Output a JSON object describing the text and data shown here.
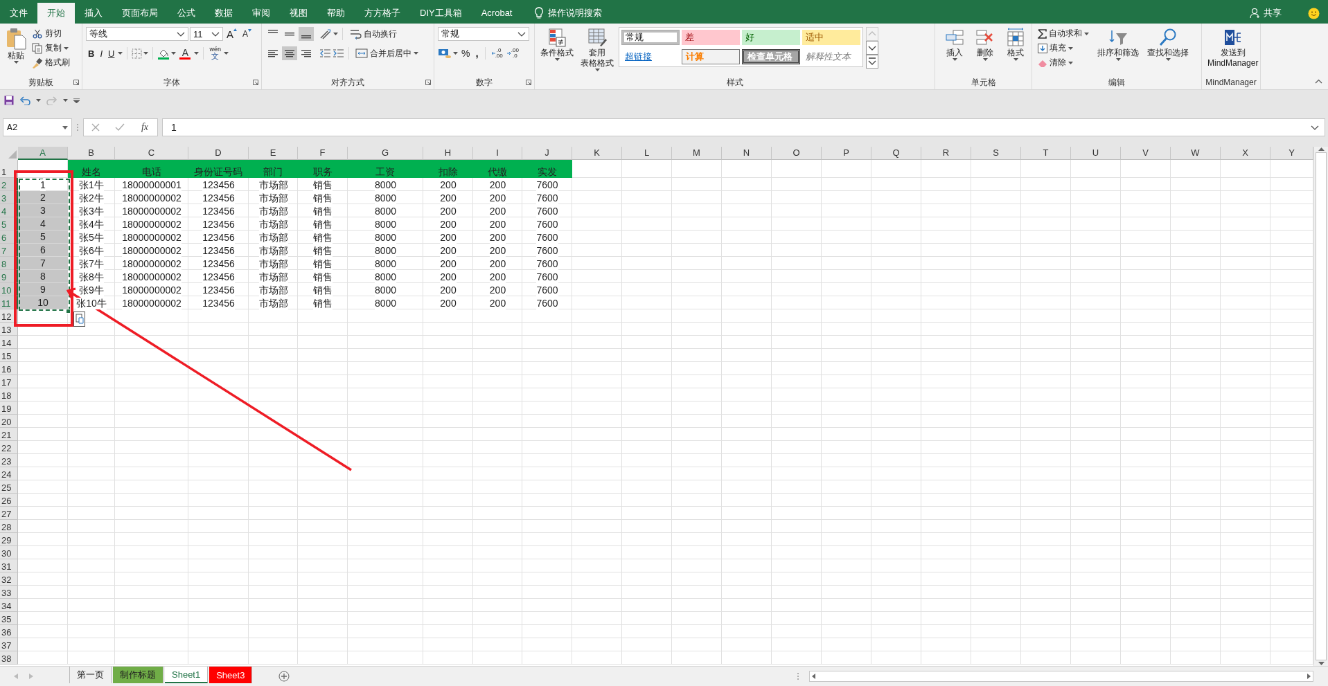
{
  "menu_tabs": [
    {
      "label": "文件",
      "selected": false
    },
    {
      "label": "开始",
      "selected": true
    },
    {
      "label": "插入",
      "selected": false
    },
    {
      "label": "页面布局",
      "selected": false
    },
    {
      "label": "公式",
      "selected": false
    },
    {
      "label": "数据",
      "selected": false
    },
    {
      "label": "审阅",
      "selected": false
    },
    {
      "label": "视图",
      "selected": false
    },
    {
      "label": "帮助",
      "selected": false
    },
    {
      "label": "方方格子",
      "selected": false
    },
    {
      "label": "DIY工具箱",
      "selected": false
    },
    {
      "label": "Acrobat",
      "selected": false
    }
  ],
  "tell_me": "操作说明搜索",
  "share": "共享",
  "ribbon_groups": [
    {
      "kind": "clipboard",
      "title": "剪贴板",
      "paste": "粘贴",
      "cut": "剪切",
      "copy": "复制",
      "format_painter": "格式刷"
    },
    {
      "kind": "font",
      "title": "字体",
      "font_name": "等线",
      "font_size": "11",
      "size_buttons": [
        {
          "kind": "grow",
          "label": "A"
        },
        {
          "kind": "shrink",
          "label": "A"
        }
      ],
      "text_styles": [
        {
          "kind": "bold",
          "label": "B"
        },
        {
          "kind": "italic",
          "label": "I"
        },
        {
          "kind": "underline",
          "label": "U"
        }
      ],
      "font_color": "A",
      "phonetic": {
        "top": "wén",
        "bottom": "文"
      }
    },
    {
      "kind": "alignment",
      "title": "对齐方式",
      "vertical_align": [
        {
          "selected": false
        },
        {
          "selected": false
        },
        {
          "selected": true
        }
      ],
      "horizontal_align": [
        {
          "selected": false
        },
        {
          "selected": true
        },
        {
          "selected": false
        }
      ],
      "wrap": "自动换行",
      "merge": "合并后居中"
    },
    {
      "kind": "number",
      "title": "数字",
      "format": "常规",
      "percent": "%",
      "comma": ",",
      "decimal_buttons": [
        {
          "kind": "increase",
          "lines": [
            ".0",
            ".00"
          ]
        },
        {
          "kind": "decrease",
          "lines": [
            ".00",
            ".0"
          ]
        }
      ]
    },
    {
      "kind": "styles",
      "title": "样式",
      "conditional": [
        "条件格式"
      ],
      "table_format": [
        "套用",
        "表格格式"
      ],
      "cell_styles": [
        {
          "kind": "normal",
          "label": "常规",
          "selected": true
        },
        {
          "kind": "bad",
          "label": "差",
          "selected": false
        },
        {
          "kind": "good",
          "label": "好",
          "selected": false
        },
        {
          "kind": "neutral",
          "label": "适中",
          "selected": false
        },
        {
          "kind": "hyperlink",
          "label": "超链接",
          "selected": false
        },
        {
          "kind": "calculation",
          "label": "计算",
          "selected": false
        },
        {
          "kind": "check",
          "label": "检查单元格",
          "selected": false
        },
        {
          "kind": "explanatory",
          "label": "解释性文本",
          "selected": false
        }
      ]
    },
    {
      "kind": "cells",
      "title": "单元格",
      "buttons": [
        {
          "kind": "insert",
          "label": "插入"
        },
        {
          "kind": "delete",
          "label": "删除"
        },
        {
          "kind": "format",
          "label": "格式"
        }
      ]
    },
    {
      "kind": "editing",
      "title": "编辑",
      "autosum": "自动求和",
      "fill": "填充",
      "clear": "清除",
      "sort": "排序和筛选",
      "find": "查找和选择"
    },
    {
      "kind": "mindmanager",
      "title": "MindManager",
      "send": [
        "发送到",
        "MindManager"
      ]
    }
  ],
  "formula_bar": {
    "name_box": "A2",
    "function_label": "fx",
    "value": "1"
  },
  "grid": {
    "columns": [
      {
        "label": "A",
        "selected": true
      },
      {
        "label": "B",
        "selected": false
      },
      {
        "label": "C",
        "selected": false
      },
      {
        "label": "D",
        "selected": false
      },
      {
        "label": "E",
        "selected": false
      },
      {
        "label": "F",
        "selected": false
      },
      {
        "label": "G",
        "selected": false
      },
      {
        "label": "H",
        "selected": false
      },
      {
        "label": "I",
        "selected": false
      },
      {
        "label": "J",
        "selected": false
      },
      {
        "label": "K",
        "selected": false
      },
      {
        "label": "L",
        "selected": false
      },
      {
        "label": "M",
        "selected": false
      },
      {
        "label": "N",
        "selected": false
      },
      {
        "label": "O",
        "selected": false
      },
      {
        "label": "P",
        "selected": false
      },
      {
        "label": "Q",
        "selected": false
      },
      {
        "label": "R",
        "selected": false
      },
      {
        "label": "S",
        "selected": false
      },
      {
        "label": "T",
        "selected": false
      },
      {
        "label": "U",
        "selected": false
      },
      {
        "label": "V",
        "selected": false
      },
      {
        "label": "W",
        "selected": false
      },
      {
        "label": "X",
        "selected": false
      },
      {
        "label": "Y",
        "selected": false
      }
    ],
    "row_headers": [
      {
        "label": "1",
        "selected": false
      },
      {
        "label": "2",
        "selected": true
      },
      {
        "label": "3",
        "selected": true
      },
      {
        "label": "4",
        "selected": true
      },
      {
        "label": "5",
        "selected": true
      },
      {
        "label": "6",
        "selected": true
      },
      {
        "label": "7",
        "selected": true
      },
      {
        "label": "8",
        "selected": true
      },
      {
        "label": "9",
        "selected": true
      },
      {
        "label": "10",
        "selected": true
      },
      {
        "label": "11",
        "selected": true
      },
      {
        "label": "12",
        "selected": false
      },
      {
        "label": "13",
        "selected": false
      },
      {
        "label": "14",
        "selected": false
      },
      {
        "label": "15",
        "selected": false
      },
      {
        "label": "16",
        "selected": false
      },
      {
        "label": "17",
        "selected": false
      },
      {
        "label": "18",
        "selected": false
      },
      {
        "label": "19",
        "selected": false
      },
      {
        "label": "20",
        "selected": false
      },
      {
        "label": "21",
        "selected": false
      },
      {
        "label": "22",
        "selected": false
      },
      {
        "label": "23",
        "selected": false
      },
      {
        "label": "24",
        "selected": false
      },
      {
        "label": "25",
        "selected": false
      },
      {
        "label": "26",
        "selected": false
      },
      {
        "label": "27",
        "selected": false
      },
      {
        "label": "28",
        "selected": false
      },
      {
        "label": "29",
        "selected": false
      },
      {
        "label": "30",
        "selected": false
      },
      {
        "label": "31",
        "selected": false
      },
      {
        "label": "32",
        "selected": false
      },
      {
        "label": "33",
        "selected": false
      },
      {
        "label": "34",
        "selected": false
      },
      {
        "label": "35",
        "selected": false
      },
      {
        "label": "36",
        "selected": false
      },
      {
        "label": "37",
        "selected": false
      },
      {
        "label": "38",
        "selected": false
      }
    ],
    "header_row": [
      "姓名",
      "电话",
      "身份证号码",
      "部门",
      "职务",
      "工资",
      "扣除",
      "代缴",
      "实发"
    ],
    "rows": [
      {
        "selected": true,
        "active": true,
        "cells": [
          "1",
          "张1牛",
          "18000000001",
          "123456",
          "市场部",
          "销售",
          "8000",
          "200",
          "200",
          "7600"
        ]
      },
      {
        "selected": true,
        "active": false,
        "cells": [
          "2",
          "张2牛",
          "18000000002",
          "123456",
          "市场部",
          "销售",
          "8000",
          "200",
          "200",
          "7600"
        ]
      },
      {
        "selected": true,
        "active": false,
        "cells": [
          "3",
          "张3牛",
          "18000000002",
          "123456",
          "市场部",
          "销售",
          "8000",
          "200",
          "200",
          "7600"
        ]
      },
      {
        "selected": true,
        "active": false,
        "cells": [
          "4",
          "张4牛",
          "18000000002",
          "123456",
          "市场部",
          "销售",
          "8000",
          "200",
          "200",
          "7600"
        ]
      },
      {
        "selected": true,
        "active": false,
        "cells": [
          "5",
          "张5牛",
          "18000000002",
          "123456",
          "市场部",
          "销售",
          "8000",
          "200",
          "200",
          "7600"
        ]
      },
      {
        "selected": true,
        "active": false,
        "cells": [
          "6",
          "张6牛",
          "18000000002",
          "123456",
          "市场部",
          "销售",
          "8000",
          "200",
          "200",
          "7600"
        ]
      },
      {
        "selected": true,
        "active": false,
        "cells": [
          "7",
          "张7牛",
          "18000000002",
          "123456",
          "市场部",
          "销售",
          "8000",
          "200",
          "200",
          "7600"
        ]
      },
      {
        "selected": true,
        "active": false,
        "cells": [
          "8",
          "张8牛",
          "18000000002",
          "123456",
          "市场部",
          "销售",
          "8000",
          "200",
          "200",
          "7600"
        ]
      },
      {
        "selected": true,
        "active": false,
        "cells": [
          "9",
          "张9牛",
          "18000000002",
          "123456",
          "市场部",
          "销售",
          "8000",
          "200",
          "200",
          "7600"
        ]
      },
      {
        "selected": true,
        "active": false,
        "cells": [
          "10",
          "张10牛",
          "18000000002",
          "123456",
          "市场部",
          "销售",
          "8000",
          "200",
          "200",
          "7600"
        ]
      }
    ],
    "annotation_rectangle": true,
    "annotation_arrow": true
  },
  "sheet_tabs": [
    {
      "label": "第一页",
      "selected": false
    },
    {
      "label": "制作标题",
      "selected": false,
      "color": "#70ad47"
    },
    {
      "label": "Sheet1",
      "selected": true
    },
    {
      "label": "Sheet3",
      "selected": false,
      "color": "#ff0000"
    }
  ]
}
